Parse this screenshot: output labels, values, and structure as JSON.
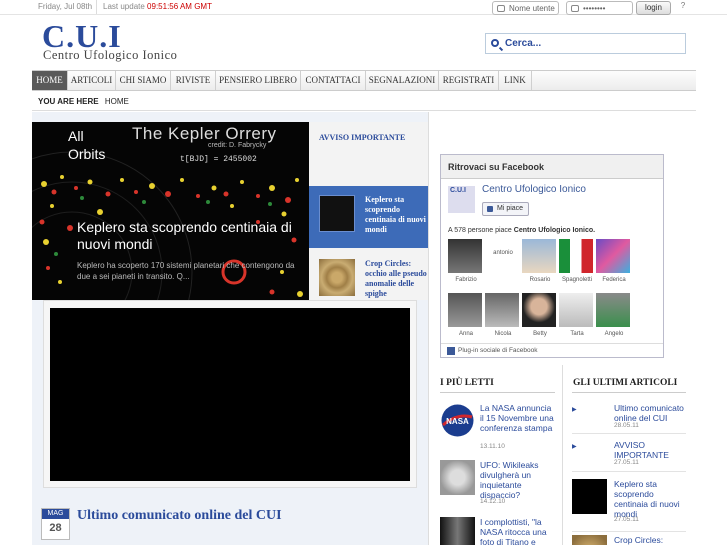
{
  "topbar": {
    "date": "Friday, Jul 08th",
    "last_update_label": "Last update",
    "last_update_time": "09:51:56 AM GMT",
    "username_placeholder": "Nome utente",
    "password_value": "••••••••",
    "login_label": "login",
    "help_icon": "help-icon"
  },
  "header": {
    "logo_text": "C.U.I",
    "logo_subtitle": "Centro Ufologico Ionico",
    "search_placeholder": "Cerca..."
  },
  "nav": {
    "items": [
      "HOME",
      "ARTICOLI",
      "CHI SIAMO",
      "RIVISTE",
      "PENSIERO LIBERO",
      "CONTATTACI",
      "SEGNALAZIONI",
      "REGISTRATI",
      "LINK"
    ],
    "active_index": 0
  },
  "breadcrumb": {
    "label": "YOU ARE HERE",
    "current": "HOME"
  },
  "slider": {
    "image_text_all": "All",
    "image_text_orbits": "Orbits",
    "image_text_title": "The Kepler Orrery",
    "image_text_credit": "credit: D. Fabrycky",
    "image_text_bjd": "t[BJD] = 2455002",
    "caption_title": "Keplero sta scoprendo centinaia di nuovi mondi",
    "caption_text": "Keplero ha scoperto 170 sistemi planetari che contengono da due a sei pianeti in transito. Q...",
    "side_header": "AVVISO IMPORTANTE",
    "thumbs": [
      {
        "title": "Keplero sta scoprendo centinaia di nuovi mondi",
        "active": true
      },
      {
        "title": "Crop Circles: occhio alle pseudo anomalie delle spighe",
        "active": false
      }
    ]
  },
  "post": {
    "month": "MAG",
    "day": "28",
    "title": "Ultimo comunicato online del CUI"
  },
  "facebook": {
    "header": "Ritrovaci su Facebook",
    "page_name": "Centro Ufologico Ionico",
    "page_logo_text": "C.U.I",
    "like_label": "Mi piace",
    "count_prefix": "A 578 persone piace",
    "count_page": "Centro Ufologico Ionico.",
    "faces": [
      "Fabrizio",
      "antonio",
      "Rosario",
      "Spagnoletti",
      "Federica",
      "Anna",
      "Nicola",
      "Betty",
      "Tarta",
      "Angelo"
    ],
    "footer": "Plug-in sociale di Facebook"
  },
  "piu_letti": {
    "header": "I PIÙ LETTI",
    "items": [
      {
        "title": "La NASA annuncia il 15 Novembre una conferenza stampa",
        "date": "13.11.10"
      },
      {
        "title": "UFO: Wikileaks divulgherà un inquietante dispaccio?",
        "date": "14.12.10"
      },
      {
        "title": "I complottisti, \"la NASA ritocca una foto di Titano e",
        "date": ""
      }
    ]
  },
  "ultimi_articoli": {
    "header": "GLI ULTIMI ARTICOLI",
    "items": [
      {
        "title": "Ultimo comunicato online del CUI",
        "date": "28.05.11"
      },
      {
        "title": "AVVISO IMPORTANTE",
        "date": "27.05.11"
      },
      {
        "title": "Keplero sta scoprendo centinaia di nuovi mondi",
        "date": "27.05.11"
      },
      {
        "title": "Crop Circles:",
        "date": ""
      }
    ]
  },
  "colors": {
    "brand_blue": "#2b4b9b",
    "update_time_red": "#cc0000",
    "nav_active_bg": "#5a5a5a",
    "facebook_blue": "#3b5998"
  }
}
